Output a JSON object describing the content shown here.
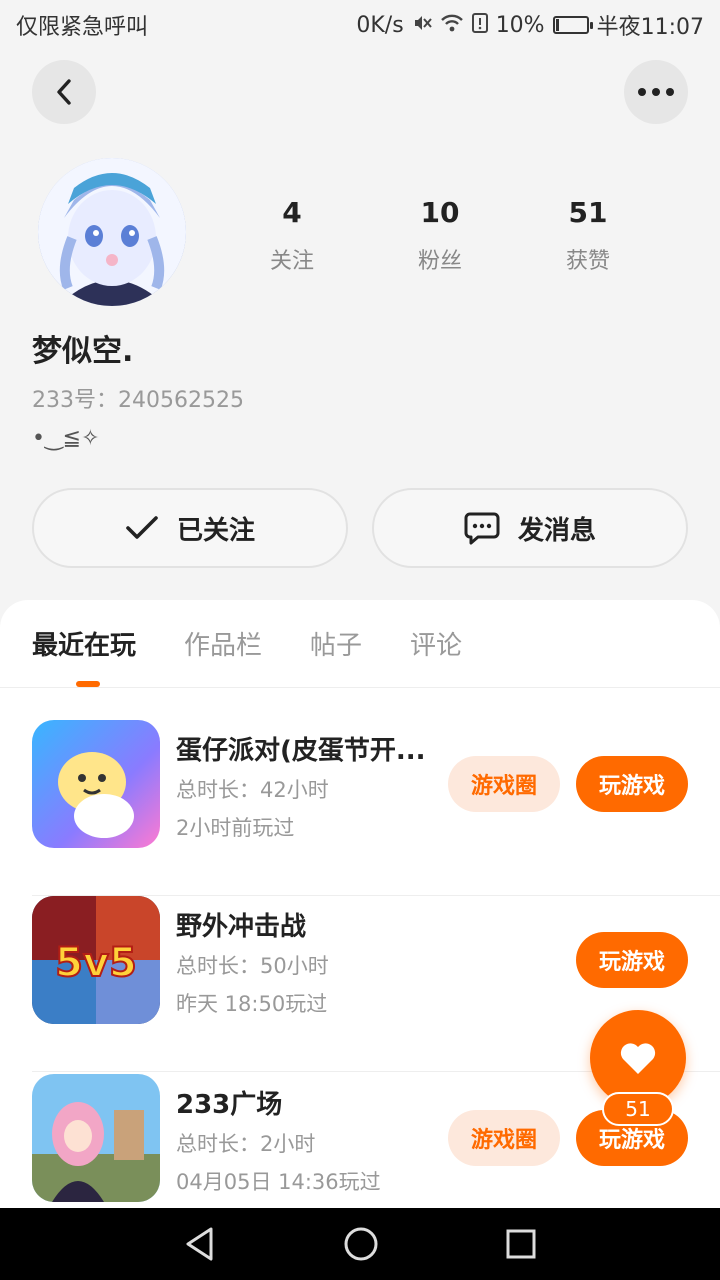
{
  "status_bar": {
    "left_text": "仅限紧急呼叫",
    "speed": "0K/s",
    "battery": "10%",
    "time": "半夜11:07"
  },
  "profile": {
    "stats": [
      {
        "value": "4",
        "label": "关注"
      },
      {
        "value": "10",
        "label": "粉丝"
      },
      {
        "value": "51",
        "label": "获赞"
      }
    ],
    "nickname": "梦似空.",
    "id_label": "233号：",
    "id_value": "240562525",
    "bio": "•‿≦✧"
  },
  "actions": {
    "follow_label": "已关注",
    "message_label": "发消息"
  },
  "tabs": [
    "最近在玩",
    "作品栏",
    "帖子",
    "评论"
  ],
  "games": [
    {
      "name": "蛋仔派对(皮蛋节开...",
      "time": "总时长：42小时",
      "last": "2小时前玩过",
      "circle_label": "游戏圈",
      "play_label": "玩游戏"
    },
    {
      "name": "野外冲击战",
      "time": "总时长：50小时",
      "last": "昨天 18:50玩过",
      "play_label": "玩游戏",
      "icon_text": "5v5"
    },
    {
      "name": "233广场",
      "time": "总时长：2小时",
      "last": "04月05日 14:36玩过",
      "circle_label": "游戏圈",
      "play_label": "玩游戏"
    }
  ],
  "fab": {
    "count": "51"
  },
  "colors": {
    "accent": "#ff6a00",
    "accent_light": "#fde8dc"
  }
}
